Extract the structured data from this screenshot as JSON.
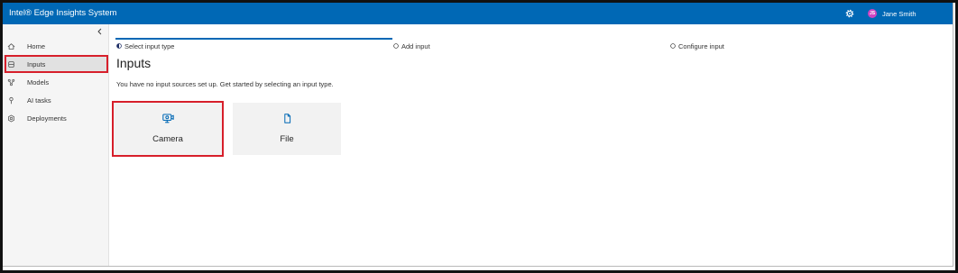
{
  "app": {
    "title": "Intel® Edge Insights System"
  },
  "header": {
    "settings_icon": "gear-icon",
    "user": {
      "initials": "JS",
      "name": "Jane Smith"
    }
  },
  "sidebar": {
    "collapse_icon": "chevron-left-icon",
    "items": [
      {
        "label": "Home",
        "icon": "home-icon",
        "selected": false,
        "highlighted": false
      },
      {
        "label": "Inputs",
        "icon": "inputs-icon",
        "selected": true,
        "highlighted": true
      },
      {
        "label": "Models",
        "icon": "models-icon",
        "selected": false,
        "highlighted": false
      },
      {
        "label": "AI tasks",
        "icon": "ai-tasks-icon",
        "selected": false,
        "highlighted": false
      },
      {
        "label": "Deployments",
        "icon": "deployments-icon",
        "selected": false,
        "highlighted": false
      }
    ]
  },
  "stepper": {
    "steps": [
      {
        "label": "Select input type",
        "icon": "step-in-progress-icon",
        "active": true
      },
      {
        "label": "Add input",
        "icon": "step-pending-icon",
        "active": false
      },
      {
        "label": "Configure input",
        "icon": "step-pending-icon",
        "active": false
      }
    ]
  },
  "main": {
    "title": "Inputs",
    "description": "You have no input sources set up. Get started by selecting an input type.",
    "input_types": [
      {
        "label": "Camera",
        "icon": "camera-icon",
        "highlighted": true
      },
      {
        "label": "File",
        "icon": "file-icon",
        "highlighted": false
      }
    ]
  },
  "colors": {
    "header": "#0068b5",
    "accent": "#0068b5",
    "annotation": "#d71f2b",
    "avatar": "#d045c2",
    "sidebar_bg": "#f5f5f5",
    "selected_bg": "#e1e1e1",
    "card_bg": "#f2f2f2"
  }
}
